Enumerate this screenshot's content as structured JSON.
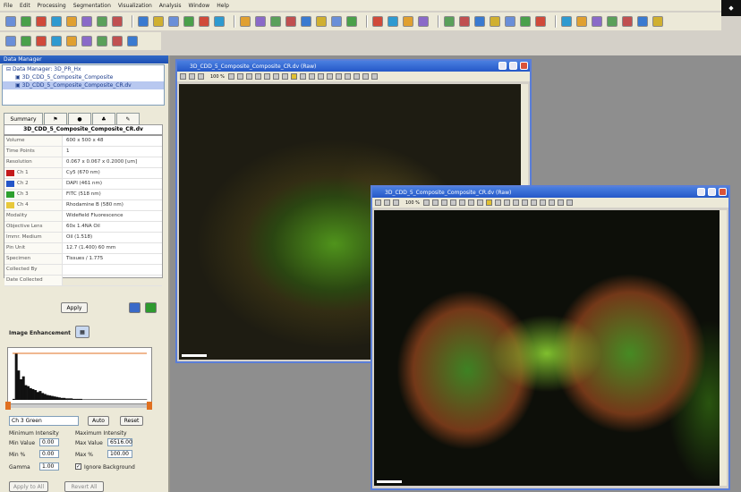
{
  "menubar": {
    "items": [
      "File",
      "Edit",
      "Processing",
      "Segmentation",
      "Visualization",
      "Analysis",
      "Window",
      "Help"
    ]
  },
  "tree": {
    "title": "Data Manager",
    "root": "Data Manager: 3D_PR_Hx",
    "items": [
      "3D_CDD_5_Composite_Composite",
      "3D_CDD_5_Composite_Composite_CR.dv"
    ]
  },
  "info": {
    "tabs": [
      "Summary",
      "",
      "",
      "",
      ""
    ],
    "title": "3D_CDD_5_Composite_Composite_CR.dv",
    "rows": [
      {
        "key": "Volume",
        "val": "600 x 500 x 48",
        "swatch": ""
      },
      {
        "key": "Time Points",
        "val": "1",
        "swatch": ""
      },
      {
        "key": "Resolution",
        "val": "0.067 x 0.067 x 0.2000 [um]",
        "swatch": ""
      },
      {
        "key": "Ch 1",
        "val": "Cy5 (670 nm)",
        "swatch": "#c41a1a"
      },
      {
        "key": "Ch 2",
        "val": "DAPI (461 nm)",
        "swatch": "#2456c8"
      },
      {
        "key": "Ch 3",
        "val": "FITC (518 nm)",
        "swatch": "#2ea02e"
      },
      {
        "key": "Ch 4",
        "val": "Rhodamine B (580 nm)",
        "swatch": "#e8c83a"
      },
      {
        "key": "Modality",
        "val": "Widefield Fluorescence",
        "swatch": ""
      },
      {
        "key": "Objective Lens",
        "val": "60x 1.4NA Oil",
        "swatch": ""
      },
      {
        "key": "Immr. Medium",
        "val": "Oil (1.518)",
        "swatch": ""
      },
      {
        "key": "Pin Unit",
        "val": "12.7 (1.400) 60 mm",
        "swatch": ""
      },
      {
        "key": "Specimen",
        "val": "Tissues / 1.775",
        "swatch": ""
      },
      {
        "key": "Collected By",
        "val": "",
        "swatch": ""
      },
      {
        "key": "Date Collected",
        "val": "",
        "swatch": ""
      }
    ],
    "apply_label": "Apply"
  },
  "enhance": {
    "title": "Image Enhancement",
    "histogram": [
      2,
      95,
      60,
      42,
      48,
      30,
      28,
      24,
      22,
      20,
      16,
      18,
      14,
      12,
      10,
      9,
      8,
      7,
      6,
      5,
      4,
      4,
      3,
      3,
      3,
      2,
      2,
      2,
      2,
      1,
      1,
      1,
      1,
      1,
      1,
      1,
      1,
      1,
      1,
      1,
      1,
      1,
      1,
      1,
      1,
      1,
      1,
      1,
      1,
      1,
      1,
      1,
      1,
      1,
      1,
      1
    ],
    "channel": "Ch 3 Green",
    "auto_label": "Auto",
    "reset_label": "Reset",
    "min_header": "Minimum Intensity",
    "max_header": "Maximum Intensity",
    "min_value_label": "Min Value",
    "min_value": "0.00",
    "max_value_label": "Max Value",
    "max_value": "6516.00",
    "min_pct_label": "Min %",
    "min_pct": "0.00",
    "max_pct_label": "Max %",
    "max_pct": "100.00",
    "gamma_label": "Gamma",
    "gamma": "1.00",
    "ignore_bg_label": "Ignore Background",
    "apply_all_label": "Apply to All",
    "revert_label": "Revert All"
  },
  "windows": {
    "back_title": "3D_CDD_5_Composite_Composite_CR.dv (Raw)",
    "front_title": "3D_CDD_5_Composite_Composite_CR.dv (Raw)",
    "zoom": "100 %"
  },
  "colors": {
    "accent": "#2558c8",
    "workspace": "#8e8e8e"
  }
}
